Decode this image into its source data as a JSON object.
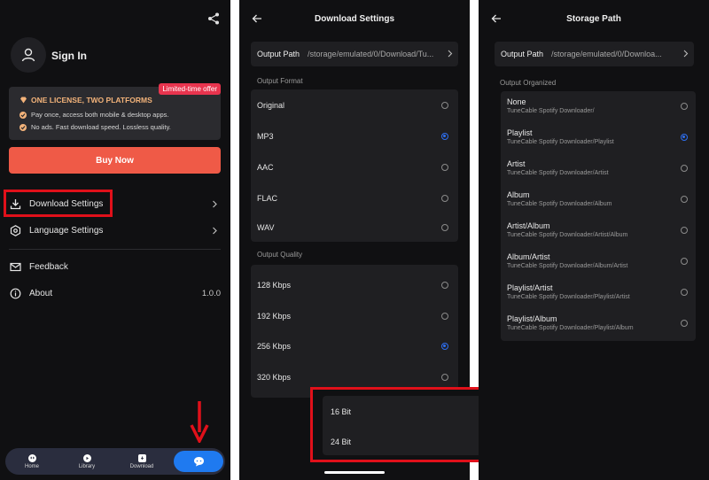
{
  "screen1": {
    "sign_in": "Sign In",
    "promo": {
      "badge": "Limited-time offer",
      "title": "ONE LICENSE, TWO PLATFORMS",
      "line1": "Pay once, access both mobile & desktop apps.",
      "line2": "No ads. Fast download speed. Lossless quality."
    },
    "buy_now": "Buy Now",
    "menu": {
      "download_settings": "Download Settings",
      "language_settings": "Language Settings",
      "feedback": "Feedback",
      "about": "About",
      "about_version": "1.0.0"
    },
    "nav": {
      "home": "Home",
      "library": "Library",
      "download": "Download"
    }
  },
  "screen2": {
    "title": "Download Settings",
    "output_path_label": "Output Path",
    "output_path_value": "/storage/emulated/0/Download/Tu...",
    "output_format_label": "Output Format",
    "formats": [
      "Original",
      "MP3",
      "AAC",
      "FLAC",
      "WAV"
    ],
    "selected_format": "MP3",
    "output_quality_label": "Output Quality",
    "qualities": [
      "128 Kbps",
      "192 Kbps",
      "256 Kbps",
      "320 Kbps"
    ],
    "selected_quality": "256 Kbps",
    "bit_depths": [
      "16 Bit",
      "24 Bit"
    ],
    "selected_bit_depth": "24 Bit"
  },
  "screen3": {
    "title": "Storage Path",
    "output_path_label": "Output Path",
    "output_path_value": "/storage/emulated/0/Downloa...",
    "output_organized_label": "Output Organized",
    "options": [
      {
        "title": "None",
        "sub": "TuneCable Spotify Downloader/"
      },
      {
        "title": "Playlist",
        "sub": "TuneCable Spotify Downloader/Playlist"
      },
      {
        "title": "Artist",
        "sub": "TuneCable Spotify Downloader/Artist"
      },
      {
        "title": "Album",
        "sub": "TuneCable Spotify Downloader/Album"
      },
      {
        "title": "Artist/Album",
        "sub": "TuneCable Spotify Downloader/Artist/Album"
      },
      {
        "title": "Album/Artist",
        "sub": "TuneCable Spotify Downloader/Album/Artist"
      },
      {
        "title": "Playlist/Artist",
        "sub": "TuneCable Spotify Downloader/Playlist/Artist"
      },
      {
        "title": "Playlist/Album",
        "sub": "TuneCable Spotify Downloader/Playlist/Album"
      }
    ],
    "selected_option": "Playlist"
  },
  "colors": {
    "background": "#101012",
    "card": "#1f1f22",
    "accent_blue": "#2e6ff0",
    "buy_button": "#ef5a47",
    "promo_gold": "#f3b37a",
    "highlight_red": "#e0101a"
  }
}
